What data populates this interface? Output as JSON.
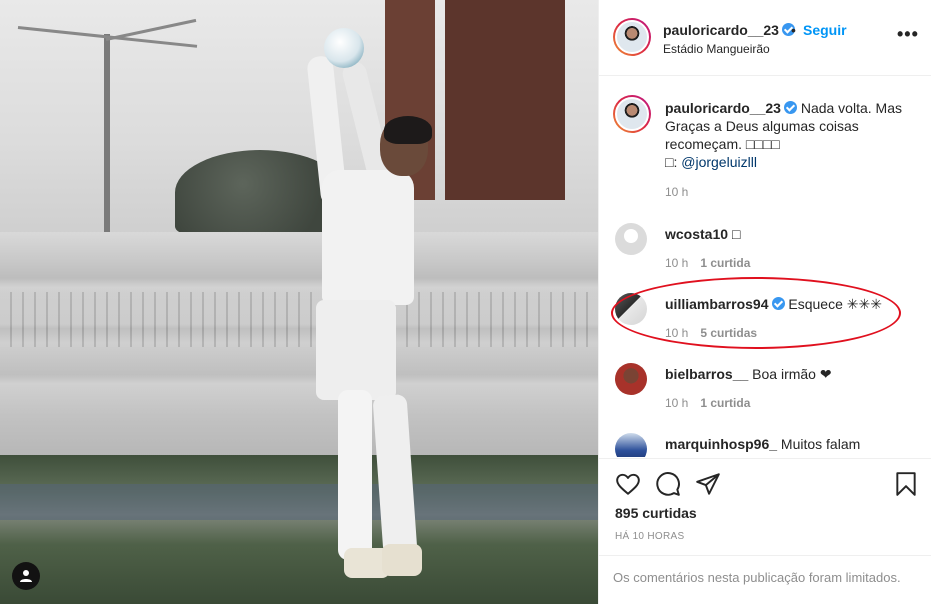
{
  "post_header": {
    "username": "pauloricardo__23",
    "dot": "•",
    "follow_label": "Seguir",
    "location": "Estádio Mangueirão",
    "more_label": "•••"
  },
  "caption": {
    "username": "pauloricardo__23",
    "text": "Nada volta. Mas Graças a Deus algumas coisas recomeçam. ",
    "emojis": "□□□□",
    "credit_prefix": "□: ",
    "credit_mention": "@jorgeluizlll",
    "time": "10 h"
  },
  "comments": [
    {
      "username": "wcosta10",
      "text": "□",
      "time": "10 h",
      "likes": "1 curtida"
    },
    {
      "username": "uilliambarros94",
      "text": "Esquece ✳✳✳",
      "time": "10 h",
      "likes": "5 curtidas"
    },
    {
      "username": "bielbarros__",
      "text": "Boa irmão ❤",
      "time": "10 h",
      "likes": "1 curtida"
    },
    {
      "username": "marquinhosp96_",
      "text": "Muitos falam",
      "time": "",
      "likes": ""
    }
  ],
  "actions": {
    "likes_count": "895 curtidas",
    "posted_time": "HÁ 10 HORAS"
  },
  "comments_limited": "Os comentários nesta publicação foram limitados.",
  "colors": {
    "accent": "#0095f6",
    "verified": "#3897f0",
    "highlight": "#e0101e",
    "muted": "#8e8e8e"
  }
}
